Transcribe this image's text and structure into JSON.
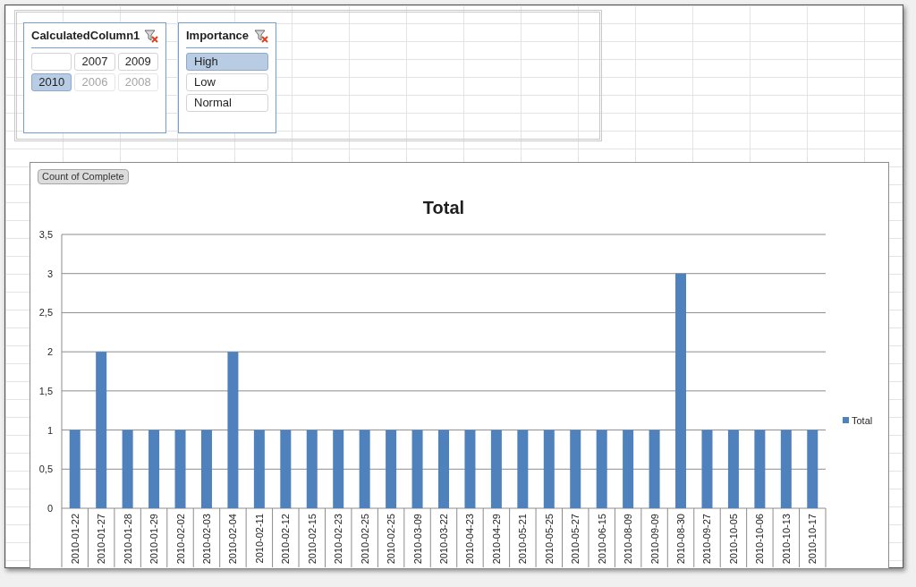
{
  "slicers": [
    {
      "title": "CalculatedColumn1",
      "kind": "grid",
      "items": [
        {
          "kind": "blank",
          "selected": false,
          "disabled": false
        },
        {
          "kind": "value",
          "label": "2007",
          "selected": false,
          "disabled": false
        },
        {
          "kind": "value",
          "label": "2009",
          "selected": false,
          "disabled": false
        },
        {
          "kind": "value",
          "label": "2010",
          "selected": true,
          "disabled": false
        },
        {
          "kind": "value",
          "label": "2006",
          "selected": false,
          "disabled": true
        },
        {
          "kind": "value",
          "label": "2008",
          "selected": false,
          "disabled": true
        }
      ]
    },
    {
      "title": "Importance",
      "kind": "list",
      "items": [
        {
          "kind": "value",
          "label": "High",
          "selected": true,
          "disabled": false
        },
        {
          "kind": "value",
          "label": "Low",
          "selected": false,
          "disabled": false
        },
        {
          "kind": "value",
          "label": "Normal",
          "selected": false,
          "disabled": false
        }
      ]
    }
  ],
  "chart": {
    "field_button": "Count of Complete",
    "chart_data": {
      "type": "bar",
      "title": "Total",
      "categories": [
        "2010-01-22",
        "2010-01-27",
        "2010-01-28",
        "2010-01-29",
        "2010-02-02",
        "2010-02-03",
        "2010-02-04",
        "2010-02-11",
        "2010-02-12",
        "2010-02-15",
        "2010-02-23",
        "2010-02-25",
        "2010-02-25",
        "2010-03-09",
        "2010-03-22",
        "2010-04-23",
        "2010-04-29",
        "2010-05-21",
        "2010-05-25",
        "2010-05-27",
        "2010-06-15",
        "2010-08-09",
        "2010-09-09",
        "2010-08-30",
        "2010-09-27",
        "2010-10-05",
        "2010-10-06",
        "2010-10-13",
        "2010-10-17"
      ],
      "series": [
        {
          "name": "Total",
          "color": "#4f81bd",
          "values": [
            1,
            2,
            1,
            1,
            1,
            1,
            2,
            1,
            1,
            1,
            1,
            1,
            1,
            1,
            1,
            1,
            1,
            1,
            1,
            1,
            1,
            1,
            1,
            3,
            1,
            1,
            1,
            1,
            1
          ]
        }
      ],
      "ylim": [
        0,
        3.5
      ],
      "grid": true,
      "yticks": [
        {
          "value": 0,
          "label": "0"
        },
        {
          "value": 0.5,
          "label": "0,5"
        },
        {
          "value": 1,
          "label": "1"
        },
        {
          "value": 1.5,
          "label": "1,5"
        },
        {
          "value": 2,
          "label": "2"
        },
        {
          "value": 2.5,
          "label": "2,5"
        },
        {
          "value": 3,
          "label": "3"
        },
        {
          "value": 3.5,
          "label": "3,5"
        }
      ]
    }
  }
}
